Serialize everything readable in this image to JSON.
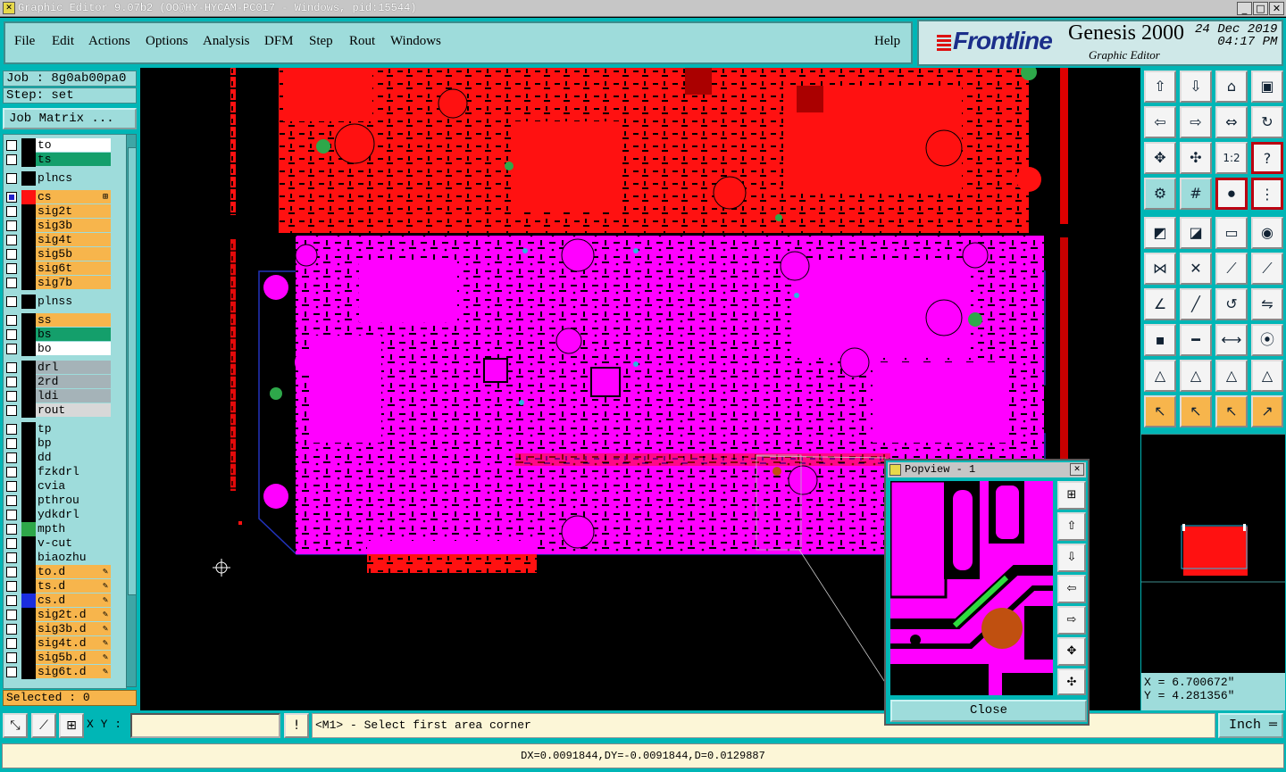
{
  "window": {
    "title": "Graphic Editor 9.07b2 (OO@HY-HYCAM-PC017 - Windows, pid:15544)",
    "min": "_",
    "max": "□",
    "close": "✕"
  },
  "menu": {
    "items": [
      "File",
      "Edit",
      "Actions",
      "Options",
      "Analysis",
      "DFM",
      "Step",
      "Rout",
      "Windows"
    ],
    "help": "Help"
  },
  "brand": {
    "logo": "Frontline",
    "product": "Genesis 2000",
    "subtitle": "Graphic Editor",
    "date": "24 Dec 2019",
    "time": "04:17 PM"
  },
  "job": {
    "job_label": "Job : 8g0ab00pa0",
    "step_label": "Step: set",
    "matrix_button": "Job Matrix ..."
  },
  "layers": [
    {
      "name": "to",
      "color": "#ffffff",
      "swatch": "#000000",
      "active": false,
      "marker": ""
    },
    {
      "name": "ts",
      "color": "#149f6b",
      "swatch": "#000000",
      "active": false,
      "marker": ""
    },
    {
      "name": "plncs",
      "color": "#9edcdb",
      "swatch": "#000000",
      "active": false,
      "marker": "",
      "gap": true
    },
    {
      "name": "cs",
      "color": "#f7b54c",
      "swatch": "#ff1111",
      "active": true,
      "marker": "⊞",
      "gap": true
    },
    {
      "name": "sig2t",
      "color": "#f7b54c",
      "swatch": "#000000",
      "active": false,
      "marker": ""
    },
    {
      "name": "sig3b",
      "color": "#f7b54c",
      "swatch": "#000000",
      "active": false,
      "marker": ""
    },
    {
      "name": "sig4t",
      "color": "#f7b54c",
      "swatch": "#000000",
      "active": false,
      "marker": ""
    },
    {
      "name": "sig5b",
      "color": "#f7b54c",
      "swatch": "#000000",
      "active": false,
      "marker": ""
    },
    {
      "name": "sig6t",
      "color": "#f7b54c",
      "swatch": "#000000",
      "active": false,
      "marker": ""
    },
    {
      "name": "sig7b",
      "color": "#f7b54c",
      "swatch": "#000000",
      "active": false,
      "marker": ""
    },
    {
      "name": "plnss",
      "color": "#9edcdb",
      "swatch": "#000000",
      "active": false,
      "marker": "",
      "gap": true
    },
    {
      "name": "ss",
      "color": "#f7b54c",
      "swatch": "#000000",
      "active": false,
      "marker": "",
      "gap": true
    },
    {
      "name": "bs",
      "color": "#149f6b",
      "swatch": "#000000",
      "active": false,
      "marker": ""
    },
    {
      "name": "bo",
      "color": "#ffffff",
      "swatch": "#000000",
      "active": false,
      "marker": ""
    },
    {
      "name": "drl",
      "color": "#a5b3b8",
      "swatch": "#000000",
      "active": false,
      "marker": "",
      "gap": true
    },
    {
      "name": "2rd",
      "color": "#a5b3b8",
      "swatch": "#000000",
      "active": false,
      "marker": ""
    },
    {
      "name": "ldi",
      "color": "#a5b3b8",
      "swatch": "#000000",
      "active": false,
      "marker": ""
    },
    {
      "name": "rout",
      "color": "#d8d8d8",
      "swatch": "#000000",
      "active": false,
      "marker": ""
    },
    {
      "name": "tp",
      "color": "#9edcdb",
      "swatch": "#000000",
      "active": false,
      "marker": "",
      "gap": true
    },
    {
      "name": "bp",
      "color": "#9edcdb",
      "swatch": "#000000",
      "active": false,
      "marker": ""
    },
    {
      "name": "dd",
      "color": "#9edcdb",
      "swatch": "#000000",
      "active": false,
      "marker": ""
    },
    {
      "name": "fzkdrl",
      "color": "#9edcdb",
      "swatch": "#000000",
      "active": false,
      "marker": ""
    },
    {
      "name": "cvia",
      "color": "#9edcdb",
      "swatch": "#000000",
      "active": false,
      "marker": ""
    },
    {
      "name": "pthrou",
      "color": "#9edcdb",
      "swatch": "#000000",
      "active": false,
      "marker": ""
    },
    {
      "name": "ydkdrl",
      "color": "#9edcdb",
      "swatch": "#000000",
      "active": false,
      "marker": ""
    },
    {
      "name": "mpth",
      "color": "#9edcdb",
      "swatch": "#2ea84a",
      "active": false,
      "marker": ""
    },
    {
      "name": "v-cut",
      "color": "#9edcdb",
      "swatch": "#000000",
      "active": false,
      "marker": ""
    },
    {
      "name": "biaozhu",
      "color": "#9edcdb",
      "swatch": "#000000",
      "active": false,
      "marker": ""
    },
    {
      "name": "to.d",
      "color": "#f7b54c",
      "swatch": "#000000",
      "active": false,
      "marker": "✎"
    },
    {
      "name": "ts.d",
      "color": "#f7b54c",
      "swatch": "#000000",
      "active": false,
      "marker": "✎"
    },
    {
      "name": "cs.d",
      "color": "#f7b54c",
      "swatch": "#1a2ee0",
      "active": false,
      "marker": "✎"
    },
    {
      "name": "sig2t.d",
      "color": "#f7b54c",
      "swatch": "#000000",
      "active": false,
      "marker": "✎"
    },
    {
      "name": "sig3b.d",
      "color": "#f7b54c",
      "swatch": "#000000",
      "active": false,
      "marker": "✎"
    },
    {
      "name": "sig4t.d",
      "color": "#f7b54c",
      "swatch": "#000000",
      "active": false,
      "marker": "✎"
    },
    {
      "name": "sig5b.d",
      "color": "#f7b54c",
      "swatch": "#000000",
      "active": false,
      "marker": "✎"
    },
    {
      "name": "sig6t.d",
      "color": "#f7b54c",
      "swatch": "#000000",
      "active": false,
      "marker": "✎"
    }
  ],
  "selected": "Selected : 0",
  "tools": [
    {
      "name": "zoom-home-icon",
      "glyph": "⇧",
      "style": ""
    },
    {
      "name": "zoom-down-icon",
      "glyph": "⇩",
      "style": ""
    },
    {
      "name": "house-icon",
      "glyph": "⌂",
      "style": ""
    },
    {
      "name": "window-split-icon",
      "glyph": "▣",
      "style": ""
    },
    {
      "name": "pan-left-icon",
      "glyph": "⇦",
      "style": ""
    },
    {
      "name": "pan-right-icon",
      "glyph": "⇨",
      "style": ""
    },
    {
      "name": "zoom-out-icon",
      "glyph": "⇔",
      "style": ""
    },
    {
      "name": "redraw-icon",
      "glyph": "↻",
      "style": ""
    },
    {
      "name": "fit-all-icon",
      "glyph": "✥",
      "style": ""
    },
    {
      "name": "fit-profile-icon",
      "glyph": "✣",
      "style": ""
    },
    {
      "name": "scale-1-2-icon",
      "glyph": "1:2",
      "style": ""
    },
    {
      "name": "help-icon",
      "glyph": "?",
      "style": "red"
    },
    {
      "name": "settings-icon",
      "glyph": "⚙",
      "style": "cyan"
    },
    {
      "name": "grid-icon",
      "glyph": "#",
      "style": "cyan"
    },
    {
      "name": "traffic-light-icon",
      "glyph": "⚫",
      "style": "red"
    },
    {
      "name": "layer-control-icon",
      "glyph": "⋮",
      "style": "red"
    },
    {
      "name": "select-object-icon",
      "glyph": "◩",
      "style": ""
    },
    {
      "name": "draw-area-icon",
      "glyph": "◪",
      "style": ""
    },
    {
      "name": "ruler-icon",
      "glyph": "▭",
      "style": ""
    },
    {
      "name": "dot-select-icon",
      "glyph": "◉",
      "style": ""
    },
    {
      "name": "connect-pads-icon",
      "glyph": "⋈",
      "style": ""
    },
    {
      "name": "cross-delete-icon",
      "glyph": "✕",
      "style": ""
    },
    {
      "name": "line-pad-icon",
      "glyph": "⟋",
      "style": ""
    },
    {
      "name": "line-pad-blue-icon",
      "glyph": "⟋",
      "style": ""
    },
    {
      "name": "angle-line-icon",
      "glyph": "∠",
      "style": ""
    },
    {
      "name": "diagonal-line-icon",
      "glyph": "╱",
      "style": ""
    },
    {
      "name": "arc-icon",
      "glyph": "↺",
      "style": ""
    },
    {
      "name": "mirror-icon",
      "glyph": "⇋",
      "style": ""
    },
    {
      "name": "pad-add-icon",
      "glyph": "▪",
      "style": ""
    },
    {
      "name": "bar-icon",
      "glyph": "━",
      "style": ""
    },
    {
      "name": "measure-icon",
      "glyph": "⟷",
      "style": ""
    },
    {
      "name": "group-pads-icon",
      "glyph": "⦿",
      "style": ""
    },
    {
      "name": "triangle-edit-icon",
      "glyph": "△",
      "style": ""
    },
    {
      "name": "triangle-line-icon",
      "glyph": "△",
      "style": ""
    },
    {
      "name": "triangle-arc-icon",
      "glyph": "△",
      "style": ""
    },
    {
      "name": "triangle-cut-icon",
      "glyph": "△",
      "style": ""
    },
    {
      "name": "pointer-icon",
      "glyph": "↖",
      "style": "orange"
    },
    {
      "name": "pointer-box-icon",
      "glyph": "↖",
      "style": "orange"
    },
    {
      "name": "pointer-frame-icon",
      "glyph": "↖",
      "style": "orange"
    },
    {
      "name": "pointer-route-icon",
      "glyph": "↗",
      "style": "orange"
    }
  ],
  "coords": {
    "x": "X = 6.700672\"",
    "y": "Y = 4.281356\""
  },
  "bottom": {
    "xy_label": "X Y :",
    "xy_value": "",
    "alert": "!",
    "prompt": "<M1> - Select first area corner",
    "unit": "Inch ═"
  },
  "status": "DX=0.0091844,DY=-0.0091844,D=0.0129887",
  "popview": {
    "title": "Popview - 1",
    "close_label": "Close",
    "close_x": "✕"
  },
  "colors": {
    "board_red": "#ff1111",
    "board_magenta": "#ff00ff",
    "panel_teal": "#00b6b6",
    "layer_orange": "#f7b54c",
    "layer_green": "#149f6b"
  }
}
